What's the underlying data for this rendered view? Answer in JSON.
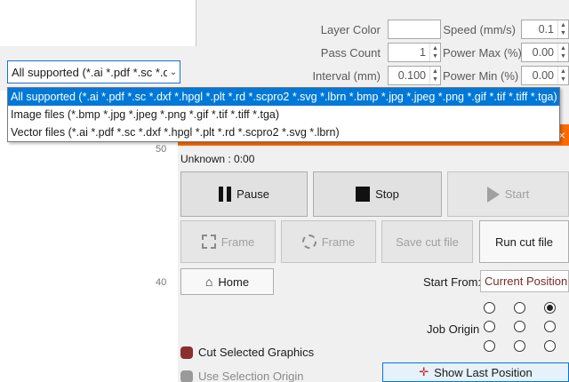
{
  "file_dialog": {
    "filetype_selected": "All supported (*.ai *.pdf *.sc *.d",
    "filetype_options": [
      "All supported (*.ai *.pdf *.sc *.dxf *.hpgl *.plt *.rd *.scpro2 *.svg *.lbrn *.bmp *.jpg *.jpeg *.png *.gif *.tif *.tiff *.tga)",
      "Image files (*.bmp *.jpg *.jpeg *.png *.gif *.tif *.tiff *.tga)",
      "Vector files (*.ai *.pdf *.sc *.dxf *.hpgl *.plt *.rd *.scpro2 *.svg *.lbrn)"
    ]
  },
  "settings": {
    "layer_color_label": "Layer Color",
    "pass_count_label": "Pass Count",
    "pass_count_value": "1",
    "interval_label": "Interval (mm)",
    "interval_value": "0.100",
    "speed_label": "Speed (mm/s)",
    "speed_value": "0.1",
    "power_max_label": "Power Max (%)",
    "power_max_value": "0.00",
    "power_min_label": "Power Min (%)",
    "power_min_value": "0.00"
  },
  "ruler": {
    "tick_50": "50",
    "tick_40": "40"
  },
  "laser_panel": {
    "close_glyph": "×",
    "status": "Unknown : 0:00",
    "pause_label": "Pause",
    "stop_label": "Stop",
    "start_label": "Start",
    "frame_label": "Frame",
    "frame_round_label": "Frame",
    "save_cut_file_label": "Save cut file",
    "run_cut_file_label": "Run cut file",
    "home_label": "Home",
    "start_from_label": "Start From:",
    "start_from_value": "Current Position",
    "job_origin_label": "Job Origin",
    "cut_selected_label": "Cut Selected Graphics",
    "use_selection_origin_label": "Use Selection Origin",
    "show_last_position_label": "Show Last Position",
    "colors": {
      "accent": "#ff6a00",
      "selection": "#0078d7",
      "checkbox_on": "#8b2e2e"
    }
  }
}
